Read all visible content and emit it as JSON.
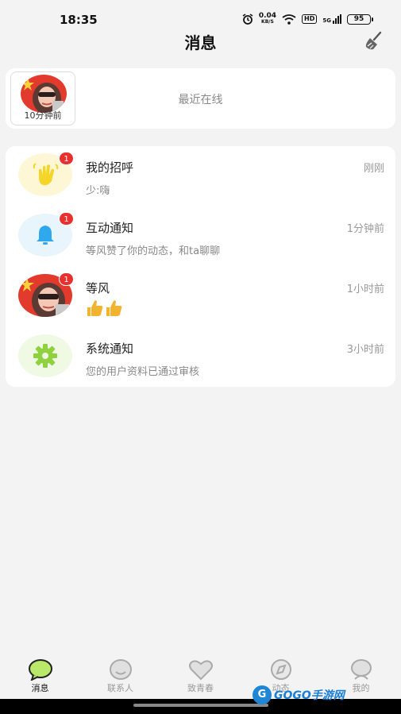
{
  "status_bar": {
    "time": "18:35",
    "speed_value": "0.04",
    "speed_unit": "KB/S",
    "hd": "HD",
    "network": "5G",
    "battery": "95"
  },
  "header": {
    "title": "消息"
  },
  "online": {
    "label": "最近在线",
    "users": [
      {
        "time": "10分钟前"
      }
    ]
  },
  "messages": [
    {
      "title": "我的招呼",
      "preview": "少:嗨",
      "time": "刚刚",
      "badge": "1",
      "icon": "wave-hand-icon",
      "color": "#f7e24a",
      "bg": "#fdf7d6"
    },
    {
      "title": "互动通知",
      "preview": "等风赞了你的动态，和ta聊聊",
      "time": "1分钟前",
      "badge": "1",
      "icon": "bell-icon",
      "color": "#2fa8ee",
      "bg": "#e8f5fc"
    },
    {
      "title": "等风",
      "preview": "👍👍",
      "time": "1小时前",
      "badge": "1",
      "icon": "avatar"
    },
    {
      "title": "系统通知",
      "preview": "您的用户资料已通过审核",
      "time": "3小时前",
      "badge": "",
      "icon": "gear-icon",
      "color": "#8fd13f",
      "bg": "#f0f9e4"
    }
  ],
  "tabs": [
    {
      "label": "消息",
      "icon": "chat-bubble-icon",
      "active": true
    },
    {
      "label": "联系人",
      "icon": "smile-face-icon",
      "active": false
    },
    {
      "label": "致青春",
      "icon": "heart-icon",
      "active": false
    },
    {
      "label": "动态",
      "icon": "compass-icon",
      "active": false
    },
    {
      "label": "我的",
      "icon": "user-icon",
      "active": false
    }
  ],
  "watermark": {
    "mark": "G",
    "text": "GOGO手游网"
  }
}
